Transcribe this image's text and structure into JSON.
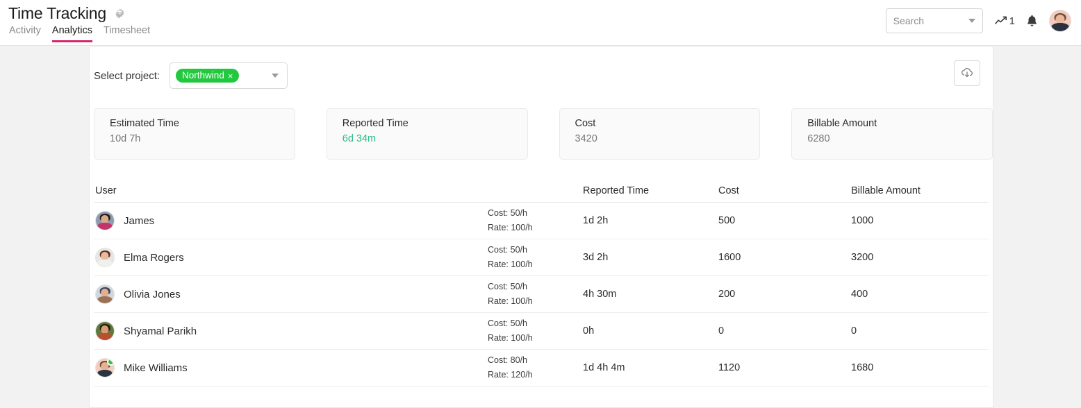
{
  "header": {
    "title": "Time Tracking",
    "settings_icon": "gear-icon",
    "tabs": [
      {
        "label": "Activity",
        "active": false
      },
      {
        "label": "Analytics",
        "active": true
      },
      {
        "label": "Timesheet",
        "active": false
      }
    ],
    "search": {
      "placeholder": "Search",
      "value": ""
    },
    "trend": {
      "icon": "trend-line-icon",
      "count": "1"
    },
    "notifications_icon": "bell-icon",
    "avatar": "user-avatar"
  },
  "toolbar": {
    "project_label": "Select project:",
    "selected_project": "Northwind",
    "remove_tag_label": "×",
    "export_icon": "cloud-download-icon"
  },
  "stats": [
    {
      "label": "Estimated Time",
      "value": "10d 7h",
      "accent": false
    },
    {
      "label": "Reported Time",
      "value": "6d 34m",
      "accent": true
    },
    {
      "label": "Cost",
      "value": "3420",
      "accent": false
    },
    {
      "label": "Billable Amount",
      "value": "6280",
      "accent": false
    }
  ],
  "table": {
    "columns": [
      "User",
      "",
      "Reported Time",
      "Cost",
      "Billable Amount"
    ],
    "rows": [
      {
        "name": "James",
        "cost_rate": "Cost: 50/h",
        "rate": "Rate: 100/h",
        "reported_time": "1d 2h",
        "cost": "500",
        "billable": "1000",
        "online": false
      },
      {
        "name": "Elma Rogers",
        "cost_rate": "Cost: 50/h",
        "rate": "Rate: 100/h",
        "reported_time": "3d 2h",
        "cost": "1600",
        "billable": "3200",
        "online": false
      },
      {
        "name": "Olivia Jones",
        "cost_rate": "Cost: 50/h",
        "rate": "Rate: 100/h",
        "reported_time": "4h 30m",
        "cost": "200",
        "billable": "400",
        "online": false
      },
      {
        "name": "Shyamal Parikh",
        "cost_rate": "Cost: 50/h",
        "rate": "Rate: 100/h",
        "reported_time": "0h",
        "cost": "0",
        "billable": "0",
        "online": false
      },
      {
        "name": "Mike Williams",
        "cost_rate": "Cost: 80/h",
        "rate": "Rate: 120/h",
        "reported_time": "1d 4h 4m",
        "cost": "1120",
        "billable": "1680",
        "online": true
      }
    ]
  },
  "colors": {
    "accent_tab": "#d6246e",
    "tag_green": "#22c93f",
    "reported_green": "#2ebd85",
    "online_green": "#27c840",
    "page_bg": "#f2f2f2",
    "card_bg": "#fafafa"
  }
}
